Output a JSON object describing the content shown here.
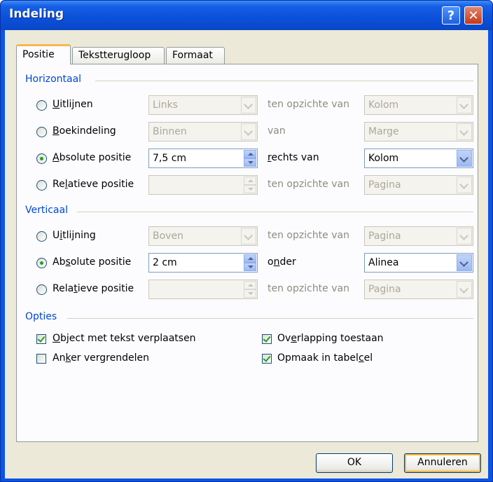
{
  "window": {
    "title": "Indeling"
  },
  "tabs": [
    "Positie",
    "Tekstterugloop",
    "Formaat"
  ],
  "horizontal": {
    "group_label": "Horizontaal",
    "rows": [
      {
        "label_pre": "",
        "label_key": "U",
        "label_post": "itlijnen",
        "value": "Links",
        "relation": "ten opzichte van",
        "target": "Kolom"
      },
      {
        "label_pre": "",
        "label_key": "B",
        "label_post": "oekindeling",
        "value": "Binnen",
        "relation": "van",
        "target": "Marge"
      },
      {
        "label_pre": "",
        "label_key": "A",
        "label_post": "bsolute positie",
        "value": "7,5 cm",
        "relation_key": "r",
        "relation_post": "echts van",
        "target": "Kolom"
      },
      {
        "label_pre": "Re",
        "label_key": "l",
        "label_post": "atieve positie",
        "value": "",
        "relation": "ten opzichte van",
        "target": "Pagina"
      }
    ]
  },
  "vertical": {
    "group_label": "Verticaal",
    "rows": [
      {
        "label_pre": "U",
        "label_key": "i",
        "label_post": "tlijning",
        "value": "Boven",
        "relation": "ten opzichte van",
        "target": "Pagina"
      },
      {
        "label_pre": "Ab",
        "label_key": "s",
        "label_post": "olute positie",
        "value": "2 cm",
        "relation_pre": "o",
        "relation_key": "n",
        "relation_post": "der",
        "target": "Alinea"
      },
      {
        "label_pre": "Rela",
        "label_key": "t",
        "label_post": "ieve positie",
        "value": "",
        "relation": "ten opzichte van",
        "target": "Pagina"
      }
    ]
  },
  "options": {
    "group_label": "Opties",
    "move_object": {
      "pre": "",
      "key": "O",
      "post": "bject met tekst verplaatsen",
      "checked": true
    },
    "lock_anchor": {
      "pre": "An",
      "key": "k",
      "post": "er vergrendelen",
      "checked": false
    },
    "allow_overlap": {
      "pre": "Ov",
      "key": "e",
      "post": "rlapping toestaan",
      "checked": true
    },
    "layout_in_cell": {
      "pre": "Opmaak in tabel",
      "key": "c",
      "post": "el",
      "checked": true
    }
  },
  "buttons": {
    "ok": "OK",
    "cancel": "Annuleren"
  },
  "colors": {
    "title_bar": "#0a55e4",
    "group_label": "#0046d5",
    "face": "#ece9d8"
  }
}
